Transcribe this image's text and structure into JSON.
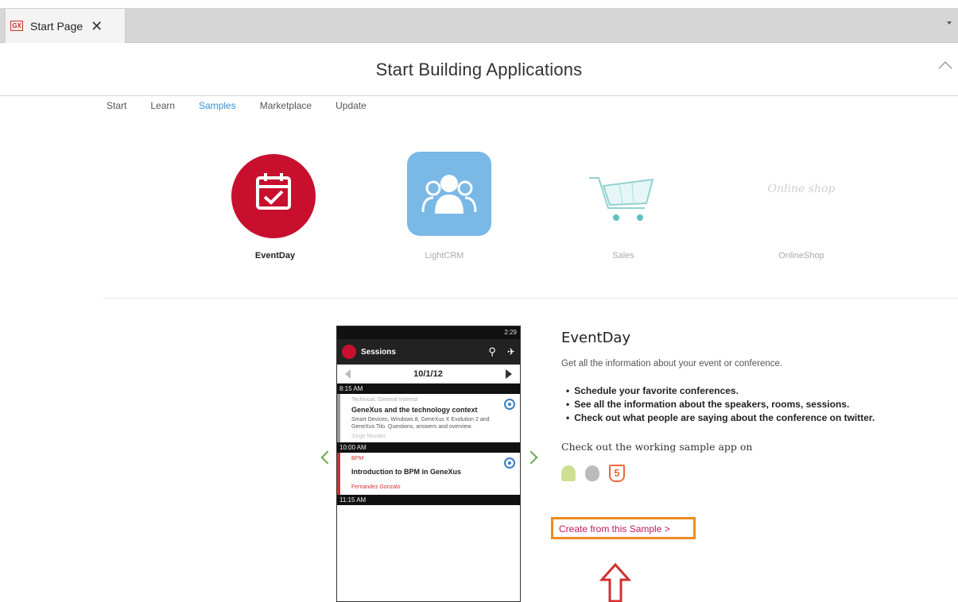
{
  "tabbar": {
    "tab_icon": "GX",
    "tab_label": "Start Page",
    "close_glyph": "✕"
  },
  "header": {
    "title": "Start Building Applications"
  },
  "nav": {
    "items": [
      "Start",
      "Learn",
      "Samples",
      "Marketplace",
      "Update"
    ],
    "active": "Samples"
  },
  "samples": [
    {
      "label": "EventDay",
      "active": true
    },
    {
      "label": "LightCRM",
      "active": false
    },
    {
      "label": "Sales",
      "active": false
    },
    {
      "label": "OnlineShop",
      "active": false,
      "logo_text": "Online shop"
    }
  ],
  "phone": {
    "status_text": "2:29",
    "app_title": "Sessions",
    "date": "10/1/12",
    "slots": [
      {
        "time": "8:15 AM",
        "category": "Technical, General Interest",
        "title": "GeneXus and the technology context",
        "description": "Smart Devices, Windows 8, GeneXus X Evolution 2 and GeneXus Tilo. Questions, answers and overview.",
        "speaker": "Jorge Nicolau"
      },
      {
        "time": "10:00 AM",
        "category": "BPM",
        "title": "Introduction to BPM in GeneXus",
        "speaker": "Fernandez Gonzalo"
      },
      {
        "time": "11:15 AM"
      }
    ]
  },
  "detail": {
    "title": "EventDay",
    "description": "Get all the information about your event or conference.",
    "features": [
      "Schedule your favorite conferences.",
      "See all the information about the speakers, rooms, sessions.",
      "Check out what people are saying about the conference on twitter."
    ],
    "check_label": "Check out the working sample app on",
    "platforms": [
      "android-icon",
      "apple-icon",
      "html5-icon"
    ],
    "create_label": "Create from this Sample >"
  },
  "colors": {
    "accent": "#3b8fd0",
    "eventday": "#c8102e",
    "lightcrm": "#7ab8e6",
    "highlight_border": "#ef8b1f",
    "arrow": "#d32f2f"
  }
}
